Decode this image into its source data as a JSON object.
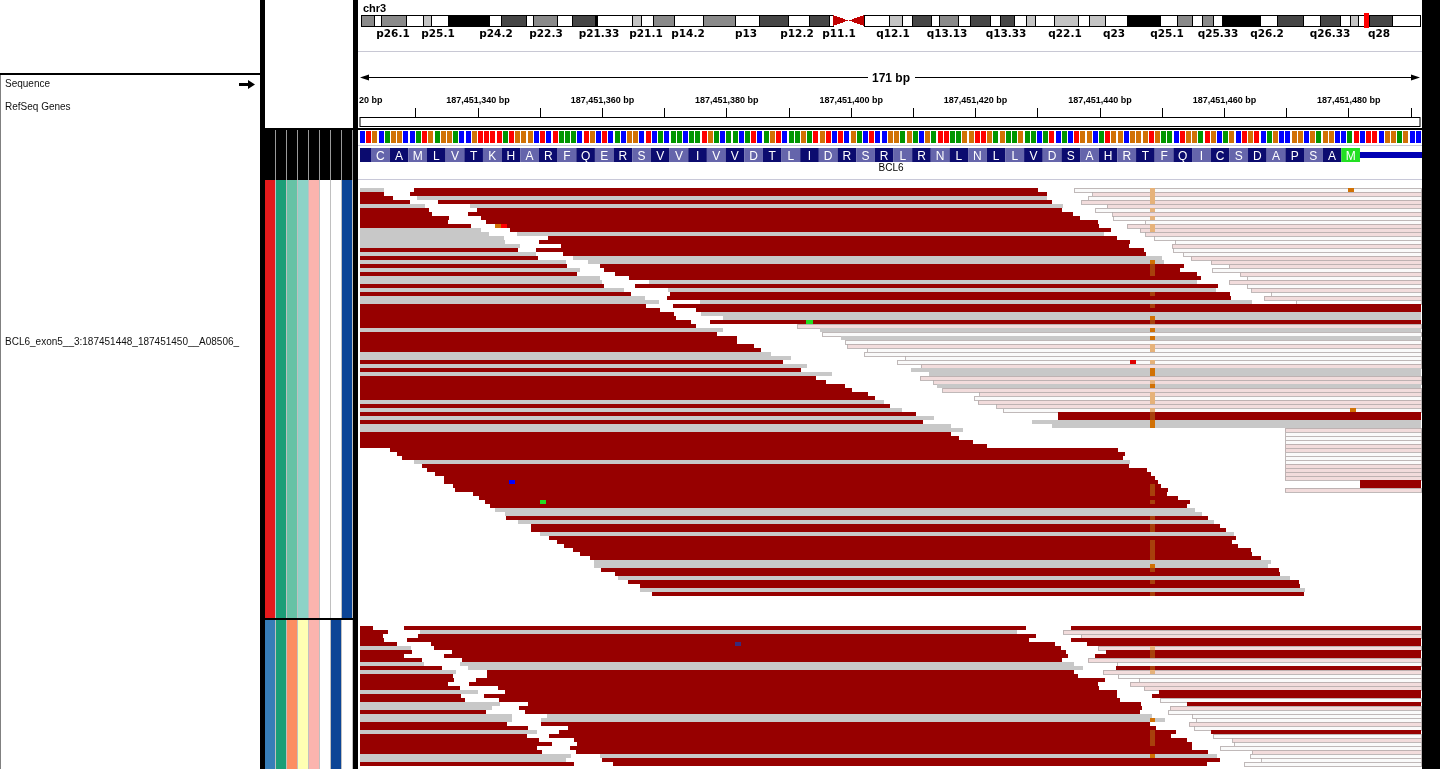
{
  "ideogram": {
    "chromosome": "chr3",
    "band_labels": [
      "p26.1",
      "p25.1",
      "p24.2",
      "p22.3",
      "p21.33",
      "p21.1",
      "p14.2",
      "p13",
      "p12.2",
      "p11.1",
      "q12.1",
      "q13.13",
      "q13.33",
      "q22.1",
      "q23",
      "q25.1",
      "q25.33",
      "q26.2",
      "q26.33",
      "q28"
    ]
  },
  "ruler": {
    "span": "171 bp",
    "tick_labels": [
      "20 bp",
      "187,451,340 bp",
      "187,451,360 bp",
      "187,451,380 bp",
      "187,451,400 bp",
      "187,451,420 bp",
      "187,451,440 bp",
      "187,451,460 bp",
      "187,451,480 bp"
    ]
  },
  "tracks": [
    {
      "name": "Sequence",
      "kind": "sequence",
      "strand_arrow": true
    },
    {
      "name": "RefSeq Genes",
      "kind": "genes",
      "gene": {
        "name": "BCL6",
        "amino_acids": [
          {
            "letter": "C",
            "start_codon": false
          },
          {
            "letter": "A",
            "start_codon": false
          },
          {
            "letter": "M",
            "start_codon": false
          },
          {
            "letter": "L",
            "start_codon": false
          },
          {
            "letter": "V",
            "start_codon": false
          },
          {
            "letter": "T",
            "start_codon": false
          },
          {
            "letter": "K",
            "start_codon": false
          },
          {
            "letter": "H",
            "start_codon": false
          },
          {
            "letter": "A",
            "start_codon": false
          },
          {
            "letter": "R",
            "start_codon": false
          },
          {
            "letter": "F",
            "start_codon": false
          },
          {
            "letter": "Q",
            "start_codon": false
          },
          {
            "letter": "E",
            "start_codon": false
          },
          {
            "letter": "R",
            "start_codon": false
          },
          {
            "letter": "S",
            "start_codon": false
          },
          {
            "letter": "V",
            "start_codon": false
          },
          {
            "letter": "V",
            "start_codon": false
          },
          {
            "letter": "I",
            "start_codon": false
          },
          {
            "letter": "V",
            "start_codon": false
          },
          {
            "letter": "V",
            "start_codon": false
          },
          {
            "letter": "D",
            "start_codon": false
          },
          {
            "letter": "T",
            "start_codon": false
          },
          {
            "letter": "L",
            "start_codon": false
          },
          {
            "letter": "I",
            "start_codon": false
          },
          {
            "letter": "D",
            "start_codon": false
          },
          {
            "letter": "R",
            "start_codon": false
          },
          {
            "letter": "S",
            "start_codon": false
          },
          {
            "letter": "R",
            "start_codon": false
          },
          {
            "letter": "L",
            "start_codon": false
          },
          {
            "letter": "R",
            "start_codon": false
          },
          {
            "letter": "N",
            "start_codon": false
          },
          {
            "letter": "L",
            "start_codon": false
          },
          {
            "letter": "N",
            "start_codon": false
          },
          {
            "letter": "L",
            "start_codon": false
          },
          {
            "letter": "L",
            "start_codon": false
          },
          {
            "letter": "V",
            "start_codon": false
          },
          {
            "letter": "D",
            "start_codon": false
          },
          {
            "letter": "S",
            "start_codon": false
          },
          {
            "letter": "A",
            "start_codon": false
          },
          {
            "letter": "H",
            "start_codon": false
          },
          {
            "letter": "R",
            "start_codon": false
          },
          {
            "letter": "T",
            "start_codon": false
          },
          {
            "letter": "F",
            "start_codon": false
          },
          {
            "letter": "Q",
            "start_codon": false
          },
          {
            "letter": "I",
            "start_codon": false
          },
          {
            "letter": "C",
            "start_codon": false
          },
          {
            "letter": "S",
            "start_codon": false
          },
          {
            "letter": "D",
            "start_codon": false
          },
          {
            "letter": "A",
            "start_codon": false
          },
          {
            "letter": "P",
            "start_codon": false
          },
          {
            "letter": "S",
            "start_codon": false
          },
          {
            "letter": "A",
            "start_codon": false
          },
          {
            "letter": "M",
            "start_codon": true
          }
        ]
      }
    }
  ],
  "samples": [
    {
      "name": "BCL6_exon5__3:187451448_187451450__A08506_",
      "attributes": [
        {
          "color": "#e41a1c"
        },
        {
          "color": "#1b9e77"
        },
        {
          "color": "#66c2a5"
        },
        {
          "color": "#8dd3c7"
        },
        {
          "color": "#fbb4ae"
        },
        {
          "color": "#ffffff"
        },
        {
          "color": "#ffffff"
        },
        {
          "color": "#0c4596"
        }
      ]
    },
    {
      "attributes": [
        {
          "color": "#377eb8"
        },
        {
          "color": "#1b9e77"
        },
        {
          "color": "#fc8d62"
        },
        {
          "color": "#ffffb3"
        },
        {
          "color": "#fbb4ae"
        },
        {
          "color": "#ffffff"
        },
        {
          "color": "#0c4596"
        },
        {
          "color": "#ffffff"
        }
      ]
    }
  ]
}
